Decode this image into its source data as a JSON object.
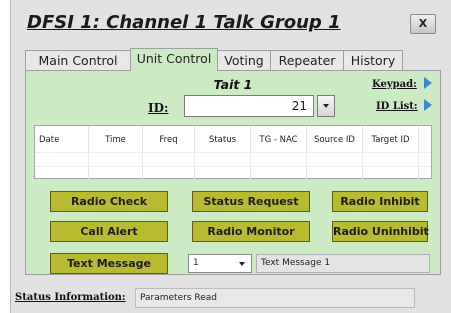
{
  "window": {
    "title": "DFSI 1: Channel 1 Talk Group 1",
    "close_label": "X"
  },
  "tabs": [
    {
      "label": "Main Control",
      "active": false
    },
    {
      "label": "Unit Control",
      "active": true
    },
    {
      "label": "Voting",
      "active": false
    },
    {
      "label": "Repeater",
      "active": false
    },
    {
      "label": "History",
      "active": false
    }
  ],
  "unit": {
    "name": "Tait 1",
    "keypad_label": "Keypad:",
    "id_list_label": "ID List:",
    "id_label": "ID:",
    "id_value": "21"
  },
  "grid": {
    "columns": [
      "Date",
      "Time",
      "Freq",
      "Status",
      "TG - NAC",
      "Source ID",
      "Target ID"
    ]
  },
  "buttons": {
    "radio_check": "Radio Check",
    "status_request": "Status Request",
    "radio_inhibit": "Radio Inhibit",
    "call_alert": "Call Alert",
    "radio_monitor": "Radio Monitor",
    "radio_uninhibit": "Radio Uninhibit",
    "text_message": "Text Message"
  },
  "message": {
    "selected": "1",
    "text": "Text Message 1"
  },
  "status": {
    "label": "Status Information:",
    "value": "Parameters Read"
  },
  "colors": {
    "panel_bg": "#ccebc4",
    "button_olive": "#b8ba2f",
    "link_arrow": "#3b87d6"
  }
}
